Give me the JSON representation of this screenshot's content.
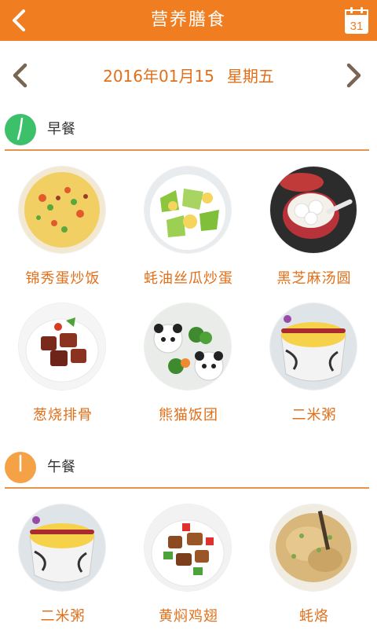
{
  "header": {
    "title": "营养膳食",
    "calendar_day": "31"
  },
  "date_nav": {
    "date": "2016年01月15",
    "weekday": "星期五"
  },
  "sections": [
    {
      "label": "早餐",
      "clock_color": "#3cc06a",
      "items": [
        {
          "name": "锦秀蛋炒饭",
          "image": "fried-rice-photo"
        },
        {
          "name": "蚝油丝瓜炒蛋",
          "image": "loofah-egg-photo"
        },
        {
          "name": "黑芝麻汤圆",
          "image": "sesame-dumplings-photo"
        },
        {
          "name": "葱烧排骨",
          "image": "scallion-ribs-photo"
        },
        {
          "name": "熊猫饭团",
          "image": "panda-rice-ball-photo"
        },
        {
          "name": "二米粥",
          "image": "millet-porridge-photo"
        }
      ]
    },
    {
      "label": "午餐",
      "clock_color": "#f5a246",
      "items": [
        {
          "name": "二米粥",
          "image": "millet-porridge-photo"
        },
        {
          "name": "黄焖鸡翅",
          "image": "braised-chicken-wings-photo"
        },
        {
          "name": "蚝烙",
          "image": "oyster-omelette-photo"
        }
      ]
    }
  ]
}
